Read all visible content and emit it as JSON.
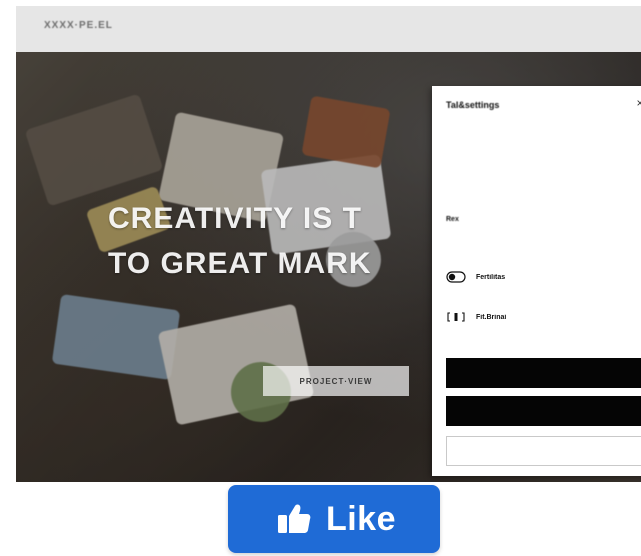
{
  "site": {
    "brand": "XXXX·PE.EL",
    "headline_line1": "CREATIVITY IS T",
    "headline_line2": "TO GREAT MARK",
    "subtext": "",
    "cta_label": "PROJECT·VIEW",
    "consent_panel": {
      "title": "Tal&settings",
      "close_label": "×",
      "body": "",
      "section_label": "Rex",
      "section_sub": "",
      "rows": [
        {
          "label": "Fertilitas"
        },
        {
          "label": "Fit.Brinai"
        }
      ],
      "buttons": {
        "accept_all": "",
        "reject_all": "",
        "manage": ""
      }
    }
  },
  "like_button": {
    "label": "Like",
    "icon": "thumbs-up-icon",
    "color": "#1f6bd6"
  },
  "colors": {
    "panel_bg": "#ffffff",
    "primary_black": "#050505",
    "topbar": "#e6e6e6"
  }
}
